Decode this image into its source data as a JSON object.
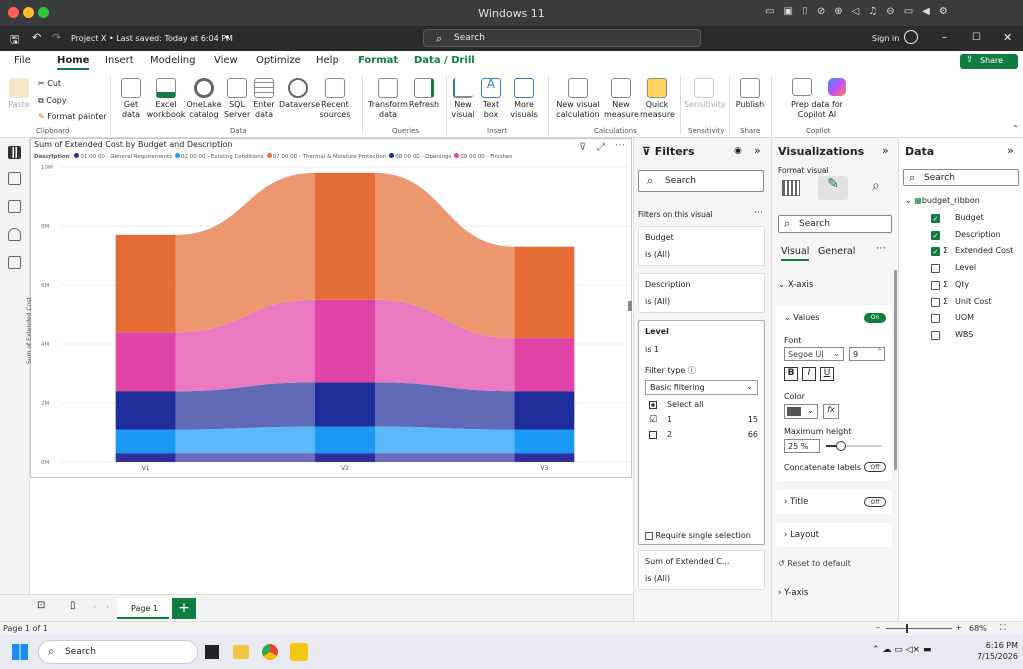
{
  "mac": {
    "title": "Windows 11"
  },
  "titlebar": {
    "quick": "Project X • Last saved: Today at 6:04 PM",
    "search": "Search",
    "signin": "Sign in"
  },
  "menu_tabs": [
    "File",
    "Home",
    "Insert",
    "Modeling",
    "View",
    "Optimize",
    "Help",
    "Format",
    "Data / Drill"
  ],
  "share_label": "Share",
  "ribbon": {
    "clipboard": {
      "paste": "Paste",
      "cut": "Cut",
      "copy": "Copy",
      "format_painter": "Format painter",
      "group": "Clipboard"
    },
    "data": {
      "get_data": "Get data",
      "excel": "Excel workbook",
      "onelake": "OneLake catalog",
      "sql": "SQL Server",
      "enter": "Enter data",
      "dataverse": "Dataverse",
      "recent": "Recent sources",
      "group": "Data"
    },
    "queries": {
      "transform": "Transform data",
      "refresh": "Refresh",
      "group": "Queries"
    },
    "insert": {
      "new_visual": "New visual",
      "text_box": "Text box",
      "more": "More visuals",
      "group": "Insert"
    },
    "calc": {
      "new_calc": "New visual calculation",
      "new_measure": "New measure",
      "quick": "Quick measure",
      "group": "Calculations"
    },
    "sensitivity": {
      "label": "Sensitivity",
      "group": "Sensitivity"
    },
    "share": {
      "publish": "Publish",
      "group": "Share"
    },
    "copilot": {
      "prep": "Prep data for Copilot AI",
      "group": "Copilot"
    }
  },
  "visual": {
    "title": "Sum of Extended Cost by Budget and Description",
    "legend_title": "Description",
    "ylabel": "Sum of Extended Cost"
  },
  "chart_data": {
    "type": "ribbon",
    "title": "Sum of Extended Cost by Budget and Description",
    "xlabel": "",
    "ylabel": "Sum of Extended Cost",
    "categories": [
      "V1",
      "V2",
      "V3"
    ],
    "y_ticks": [
      "0M",
      "2M",
      "4M",
      "6M",
      "8M",
      "10M"
    ],
    "ylim": [
      0,
      10
    ],
    "series": [
      {
        "name": "01 00 00 - General Requirements",
        "color": "#2f2f9e",
        "values": [
          0.3,
          0.3,
          0.3
        ]
      },
      {
        "name": "02 00 00 - Existing Conditions",
        "color": "#1a9af5",
        "values": [
          0.8,
          0.9,
          0.8
        ]
      },
      {
        "name": "07 00 00 - Thermal & Moisture Protection",
        "color": "#e66c37",
        "values": [
          3.3,
          4.3,
          3.1
        ]
      },
      {
        "name": "08 00 00 - Openings",
        "color": "#1f2d9a",
        "values": [
          1.3,
          1.5,
          1.3
        ]
      },
      {
        "name": "09 00 00 - Finishes",
        "color": "#e044a7",
        "values": [
          2.0,
          2.8,
          1.8
        ]
      }
    ]
  },
  "filters": {
    "title": "Filters",
    "search": "Search",
    "on_visual": "Filters on this visual",
    "cards": [
      {
        "name": "Budget",
        "value": "is (All)"
      },
      {
        "name": "Description",
        "value": "is (All)"
      }
    ],
    "level": {
      "name": "Level",
      "value": "is 1",
      "filter_type_label": "Filter type",
      "filter_type": "Basic filtering",
      "select_all": "Select all",
      "options": [
        {
          "label": "1",
          "count": "15",
          "checked": true
        },
        {
          "label": "2",
          "count": "66",
          "checked": false
        }
      ]
    },
    "require_single": "Require single selection",
    "sum_card": {
      "name": "Sum of Extended C...",
      "value": "is (All)"
    }
  },
  "viz": {
    "title": "Visualizations",
    "format_visual": "Format visual",
    "search": "Search",
    "tab_visual": "Visual",
    "tab_general": "General",
    "xaxis": "X-axis",
    "values": "Values",
    "values_toggle": "On",
    "font_label": "Font",
    "font_family": "Segoe UI",
    "font_size": "9",
    "bold": "B",
    "italic": "I",
    "underline": "U",
    "color_label": "Color",
    "fx": "fx",
    "max_height_label": "Maximum height",
    "max_height_value": "25 %",
    "concat_label": "Concatenate labels",
    "concat_toggle": "Off",
    "title_section": "Title",
    "title_toggle": "Off",
    "layout_section": "Layout",
    "reset": "Reset to default",
    "yaxis": "Y-axis"
  },
  "data_pane": {
    "title": "Data",
    "search": "Search",
    "table": "budget_ribbon",
    "fields": [
      {
        "name": "Budget",
        "checked": true,
        "sigma": false
      },
      {
        "name": "Description",
        "checked": true,
        "sigma": false
      },
      {
        "name": "Extended Cost",
        "checked": true,
        "sigma": true
      },
      {
        "name": "Level",
        "checked": false,
        "sigma": false
      },
      {
        "name": "Qty",
        "checked": false,
        "sigma": true
      },
      {
        "name": "Unit Cost",
        "checked": false,
        "sigma": true
      },
      {
        "name": "UOM",
        "checked": false,
        "sigma": false
      },
      {
        "name": "WBS",
        "checked": false,
        "sigma": false
      }
    ]
  },
  "pages": {
    "current": "Page 1",
    "status": "Page 1 of 1",
    "zoom": "68%"
  },
  "taskbar": {
    "search": "Search",
    "time": "6:16 PM",
    "date": "7/15/2026"
  }
}
